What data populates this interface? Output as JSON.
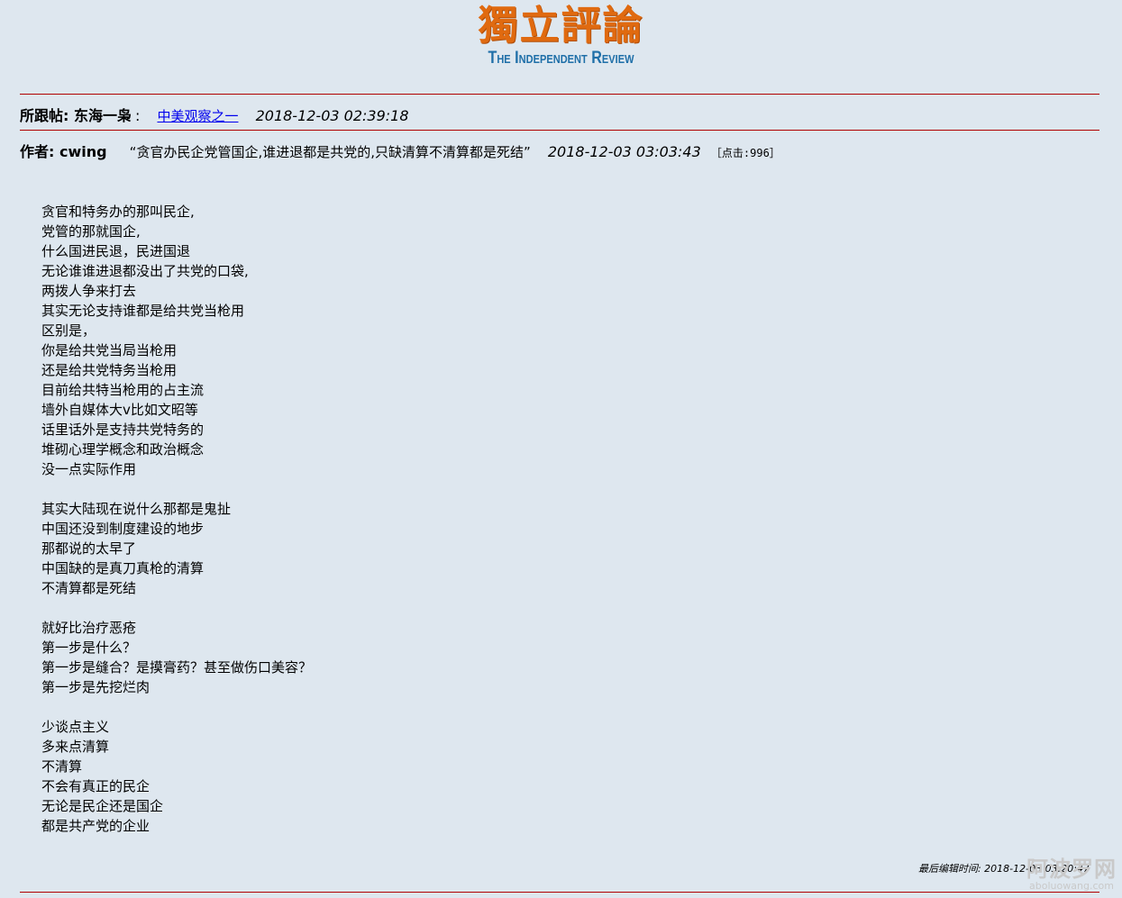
{
  "logo": {
    "chinese": "獨立評論",
    "english": "The Independent Review"
  },
  "reply_to": {
    "label": "所跟帖: 东海一枭",
    "colon": ":",
    "link_text": "中美观察之一",
    "time": "2018-12-03 02:39:18"
  },
  "post": {
    "author_label": "作者: cwing",
    "title": "“贪官办民企党管国企,谁进退都是共党的,只缺清算不清算都是死结”",
    "time": "2018-12-03 03:03:43",
    "clicks": "［点击:996］"
  },
  "content": {
    "lines": [
      "贪官和特务办的那叫民企,",
      "党管的那就国企,",
      "什么国进民退，民进国退",
      "无论谁谁进退都没出了共党的口袋,",
      "两拨人争来打去",
      "其实无论支持谁都是给共党当枪用",
      "区别是，",
      "你是给共党当局当枪用",
      "还是给共党特务当枪用",
      "目前给共特当枪用的占主流",
      "墙外自媒体大v比如文昭等",
      "话里话外是支持共党特务的",
      "堆砌心理学概念和政治概念",
      "没一点实际作用",
      "",
      "其实大陆现在说什么那都是鬼扯",
      "中国还没到制度建设的地步",
      "那都说的太早了",
      "中国缺的是真刀真枪的清算",
      "不清算都是死结",
      "",
      "就好比治疗恶疮",
      "第一步是什么？",
      "第一步是缝合？是摸膏药？甚至做伤口美容？",
      "第一步是先挖烂肉",
      "",
      "少谈点主义",
      "多来点清算",
      "不清算",
      "不会有真正的民企",
      "无论是民企还是国企",
      "都是共产党的企业"
    ]
  },
  "footer": {
    "edited": "最后编辑时间: 2018-12-03 03:20:47"
  },
  "watermark": {
    "chinese": "阿波罗网",
    "url": "aboluowang.com"
  },
  "colors": {
    "background": "#dee7ef",
    "rule": "#b00000",
    "logo_orange": "#e06a10",
    "logo_blue": "#1f6fa8",
    "link": "#0000ee"
  }
}
